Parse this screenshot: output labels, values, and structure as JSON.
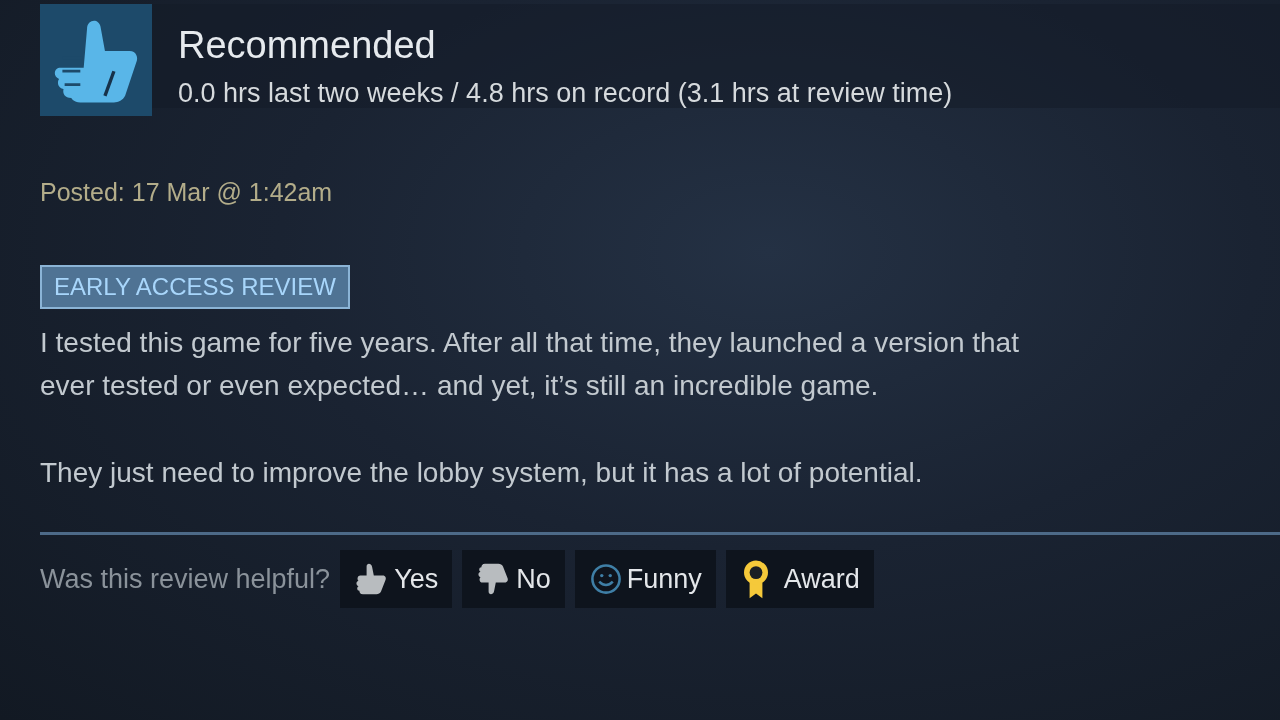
{
  "review": {
    "verdict": "Recommended",
    "recommended": true,
    "hours": "0.0 hrs last two weeks / 4.8 hrs on record (3.1 hrs at review time)",
    "posted": "Posted: 17 Mar @ 1:42am",
    "tag": "EARLY ACCESS REVIEW",
    "paragraphs": [
      [
        "I tested this game for five years. After all that time, they launched a version that",
        "ever tested or even expected… and yet, it’s still an incredible game."
      ],
      [
        "They just need to improve the lobby system, but it has a lot of potential."
      ]
    ]
  },
  "helpful": {
    "prompt": "Was this review helpful?",
    "buttons": [
      {
        "kind": "yes",
        "label": "Yes"
      },
      {
        "kind": "no",
        "label": "No"
      },
      {
        "kind": "funny",
        "label": "Funny"
      },
      {
        "kind": "award",
        "label": "Award"
      }
    ]
  }
}
